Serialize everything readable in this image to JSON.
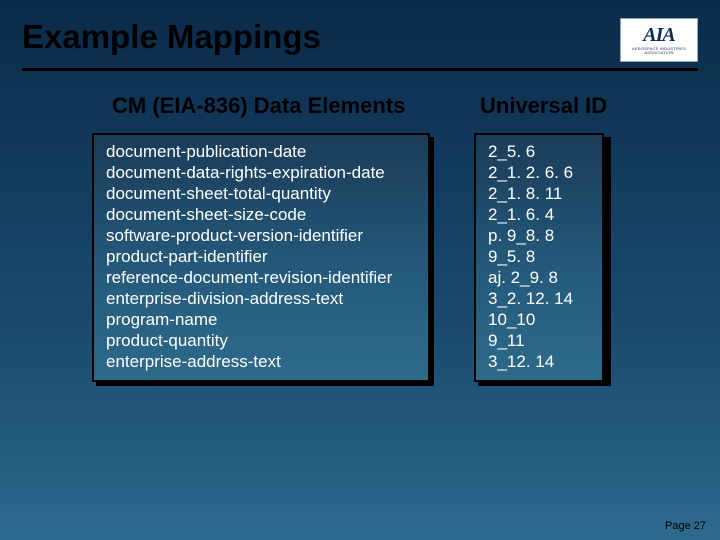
{
  "title": "Example Mappings",
  "logo": {
    "main": "AIA",
    "sub": "AEROSPACE INDUSTRIES ASSOCIATION"
  },
  "headings": {
    "left": "CM (EIA-836) Data Elements",
    "right": "Universal ID"
  },
  "rows": [
    {
      "elem": "document-publication-date",
      "uid": "2_5. 6"
    },
    {
      "elem": "document-data-rights-expiration-date",
      "uid": "2_1. 2. 6. 6"
    },
    {
      "elem": "document-sheet-total-quantity",
      "uid": "2_1. 8. 11"
    },
    {
      "elem": "document-sheet-size-code",
      "uid": "2_1. 6. 4"
    },
    {
      "elem": "software-product-version-identifier",
      "uid": "p. 9_8. 8"
    },
    {
      "elem": "product-part-identifier",
      "uid": "9_5. 8"
    },
    {
      "elem": "reference-document-revision-identifier",
      "uid": "aj. 2_9. 8"
    },
    {
      "elem": "enterprise-division-address-text",
      "uid": "3_2. 12. 14"
    },
    {
      "elem": "program-name",
      "uid": "10_10"
    },
    {
      "elem": "product-quantity",
      "uid": "9_11"
    },
    {
      "elem": "enterprise-address-text",
      "uid": "3_12. 14"
    }
  ],
  "footer": "Page 27"
}
